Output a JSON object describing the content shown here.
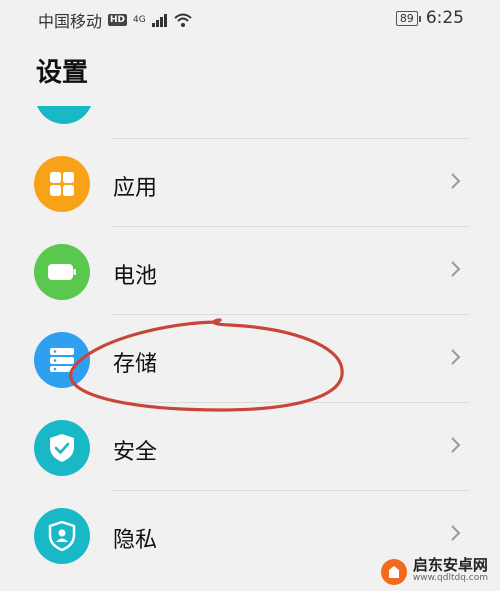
{
  "status_bar": {
    "carrier": "中国移动",
    "hd_badge": "HD",
    "network": "4G",
    "battery": "89",
    "time": "6:25"
  },
  "page": {
    "title": "设置"
  },
  "settings": {
    "items": [
      {
        "label": "应用",
        "icon": "apps-grid-icon",
        "color": "#f8a217"
      },
      {
        "label": "电池",
        "icon": "battery-icon",
        "color": "#5ac74f"
      },
      {
        "label": "存储",
        "icon": "storage-icon",
        "color": "#2f9ff0"
      },
      {
        "label": "安全",
        "icon": "shield-check-icon",
        "color": "#19b8c7"
      },
      {
        "label": "隐私",
        "icon": "privacy-shield-icon",
        "color": "#19b8c7"
      }
    ]
  },
  "annotation": {
    "color": "#c8453a"
  },
  "watermark": {
    "site_name": "启东安卓网",
    "url": "www.qdltdq.com"
  }
}
